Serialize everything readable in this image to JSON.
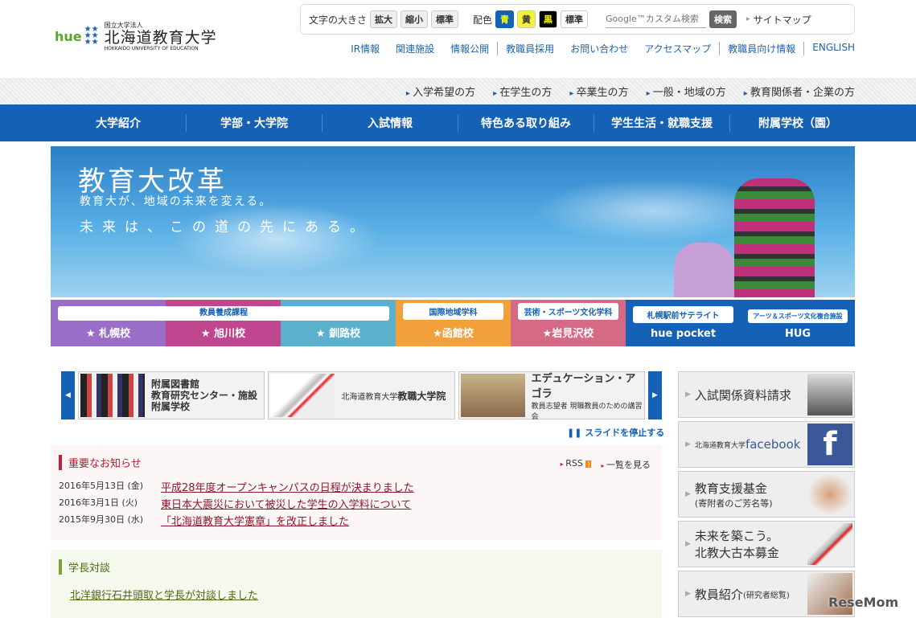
{
  "logo": {
    "brand": "hue",
    "org": "国立大学法人",
    "name": "北海道教育大学",
    "en": "HOKKAIDO UNIVERSITY OF EDUCATION"
  },
  "toolbar": {
    "font_size_label": "文字の大きさ",
    "enlarge": "拡大",
    "shrink": "縮小",
    "standard": "標準",
    "color_label": "配色",
    "blue": "青",
    "yellow": "黄",
    "black": "黒",
    "color_standard": "標準",
    "search_placeholder": "Google™カスタム検索",
    "search_button": "検索",
    "sitemap": "サイトマップ"
  },
  "utility": [
    "IR情報",
    "関連施設",
    "情報公開",
    "教職員採用",
    "お問い合わせ",
    "アクセスマップ",
    "教職員向け情報",
    "ENGLISH"
  ],
  "audience": [
    "入学希望の方",
    "在学生の方",
    "卒業生の方",
    "一般・地域の方",
    "教育関係者・企業の方"
  ],
  "gnav": [
    "大学紹介",
    "学部・大学院",
    "入試情報",
    "特色ある取り組み",
    "学生生活・就職支援",
    "附属学校（園）"
  ],
  "hero": {
    "title": "教育大改革",
    "subtitle": "教育大が、地域の未来を変える。",
    "tagline": "未来は、この道の先にある。"
  },
  "campus": {
    "teacher_course": "教員養成課程",
    "sapporo": "★ 札幌校",
    "asahikawa": "★ 旭川校",
    "kushiro": "★ 釧路校",
    "intl_label": "国際地域学科",
    "hakodate": "★函館校",
    "arts_label": "芸術・スポーツ文化学科",
    "iwamizawa": "★岩見沢校",
    "satellite_label": "札幌駅前サテライト",
    "huepocket": "hue pocket",
    "hug_label": "アーツ＆スポーツ文化複合施設",
    "hug": "HUG"
  },
  "slider": {
    "s1": [
      "附属図書館",
      "教育研究センター・施設",
      "附属学校"
    ],
    "s2_small": "北海道教育大学",
    "s2_big": "教職大学院",
    "s3_title": "エデュケーション・アゴラ",
    "s3_sub": "教員志望者 現職教員のための講習会",
    "stop": "スライドを停止する"
  },
  "news": {
    "title": "重要なお知らせ",
    "rss": "RSS",
    "list_all": "一覧を見る",
    "items": [
      {
        "date": "2016年5月13日 (金)",
        "text": "平成28年度オープンキャンパスの日程が決まりました"
      },
      {
        "date": "2016年3月1日 (火)",
        "text": "東日本大震災において被災した学生の入学料について"
      },
      {
        "date": "2015年9月30日 (水)",
        "text": "「北海道教育大学憲章」を改正しました"
      }
    ]
  },
  "dialog": {
    "title": "学長対談",
    "link": "北洋銀行石井頭取と学長が対談しました"
  },
  "side": {
    "admission": "入試関係資料請求",
    "fb_small": "北海道教育大学",
    "fb": "facebook",
    "fund": "教育支援基金",
    "fund_sub": "(寄附者のご芳名等)",
    "book1": "未来を築こう。",
    "book2": "北教大古本募金",
    "staff": "教員紹介",
    "staff_sub": "(研究者総覧)"
  },
  "watermark": "ReseMom"
}
